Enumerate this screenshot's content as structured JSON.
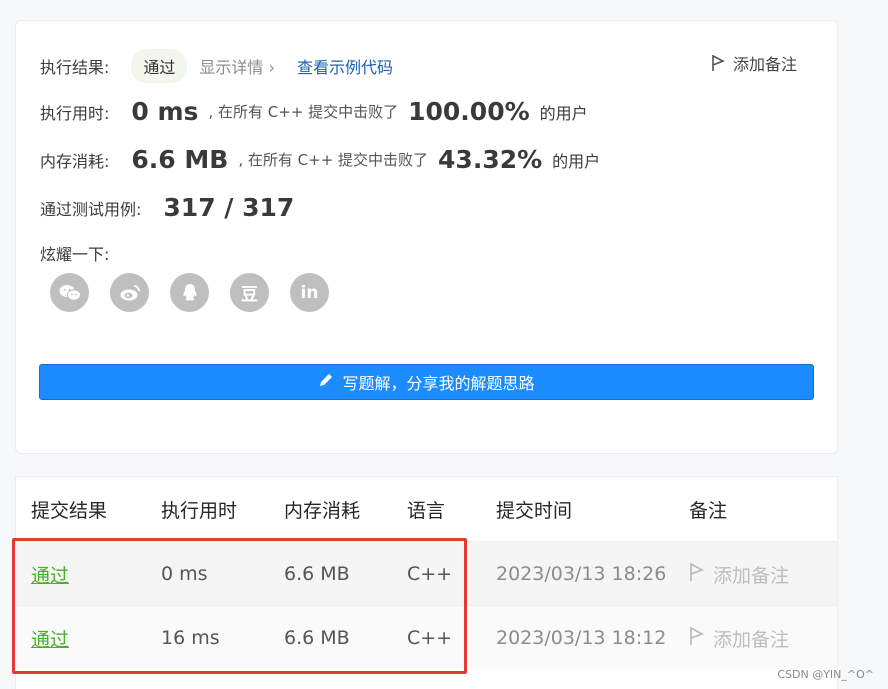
{
  "result": {
    "label": "执行结果:",
    "status": "通过",
    "details_label": "显示详情",
    "details_chevron": "›",
    "example_code_label": "查看示例代码",
    "add_note_label": "添加备注"
  },
  "runtime": {
    "label": "执行用时:",
    "value": "0 ms",
    "text_before": ", 在所有 C++ 提交中击败了",
    "percent": "100.00%",
    "text_after": "的用户"
  },
  "memory": {
    "label": "内存消耗:",
    "value": "6.6 MB",
    "text_before": ", 在所有 C++ 提交中击败了",
    "percent": "43.32%",
    "text_after": "的用户"
  },
  "tests": {
    "label": "通过测试用例:",
    "value": "317 / 317"
  },
  "share": {
    "label": "炫耀一下:",
    "icons": [
      "wechat-icon",
      "weibo-icon",
      "qq-icon",
      "douban-icon",
      "linkedin-icon"
    ],
    "douban_glyph": "豆",
    "linkedin_glyph": "in"
  },
  "write_solution": {
    "label": "写题解，分享我的解题思路"
  },
  "table": {
    "headers": [
      "提交结果",
      "执行用时",
      "内存消耗",
      "语言",
      "提交时间",
      "备注"
    ],
    "rows": [
      {
        "result": "通过",
        "runtime": "0 ms",
        "memory": "6.6 MB",
        "lang": "C++",
        "time": "2023/03/13 18:26",
        "note": "添加备注"
      },
      {
        "result": "通过",
        "runtime": "16 ms",
        "memory": "6.6 MB",
        "lang": "C++",
        "time": "2023/03/13 18:12",
        "note": "添加备注"
      }
    ]
  },
  "colors": {
    "accent": "#1a8cff",
    "pass": "#4caf28",
    "highlight": "#e53935"
  },
  "watermark": "CSDN @YIN_^O^"
}
